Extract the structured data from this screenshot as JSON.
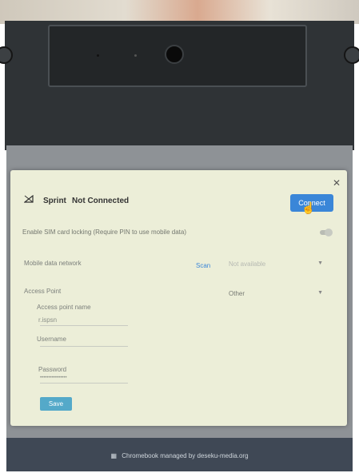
{
  "network": {
    "name": "Sprint",
    "status": "Not Connected",
    "connect_label": "Connect"
  },
  "settings": {
    "sim_lock_label": "Enable SIM card locking (Require PIN to use mobile data)",
    "mobile_network_label": "Mobile data network",
    "scan_label": "Scan",
    "carrier_value": "Not available",
    "access_point_label": "Access Point",
    "access_point_value": "Other",
    "apn_label": "Access point name",
    "apn_value": "r.ispsn",
    "username_label": "Username",
    "password_label": "Password",
    "password_value": "••••••••••••••••",
    "save_label": "Save"
  },
  "footer": {
    "managed_text": "Chromebook managed by deseku-media.org"
  },
  "colors": {
    "accent": "#3a86d8",
    "save": "#54a9c9",
    "dialog_bg": "#eceed8"
  }
}
